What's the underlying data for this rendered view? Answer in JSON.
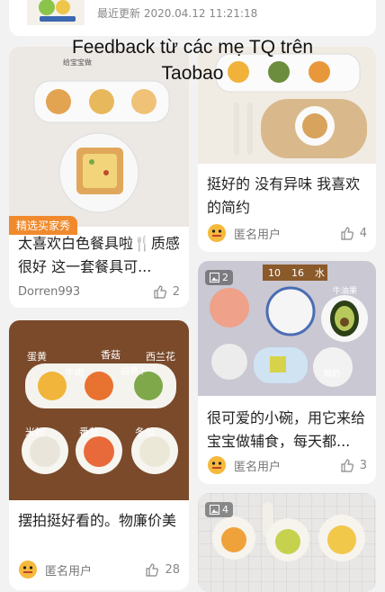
{
  "top_card": {
    "updated_text": "最近更新 2020.04.12 11:21:18"
  },
  "overlay": {
    "line1": "Feedback từ các mẹ TQ trên",
    "line2": "Taobao"
  },
  "cards": [
    {
      "tag": "精选买家秀",
      "title": "太喜欢白色餐具啦🍴质感很好 这一套餐具可...",
      "user": "Dorren993",
      "likes": "2"
    },
    {
      "title": "挺好的 没有异味 我喜欢的简约",
      "user": "匿名用户",
      "likes": "4"
    },
    {
      "photo_count": "2",
      "title": "很可爱的小碗，用它来给宝宝做辅食，每天都...",
      "user": "匿名用户",
      "likes": "3",
      "photo_labels": [
        "10",
        "16",
        "水",
        "牛油果",
        "酸奶"
      ]
    },
    {
      "title": "摆拍挺好看的。物廉价美",
      "user": "匿名用户",
      "likes": "28",
      "photo_labels": [
        "蛋黄",
        "牛肉",
        "香菇",
        "胡萝卜",
        "西兰花",
        "米粉",
        "番茄",
        "冬瓜"
      ]
    },
    {
      "photo_count": "4"
    }
  ]
}
